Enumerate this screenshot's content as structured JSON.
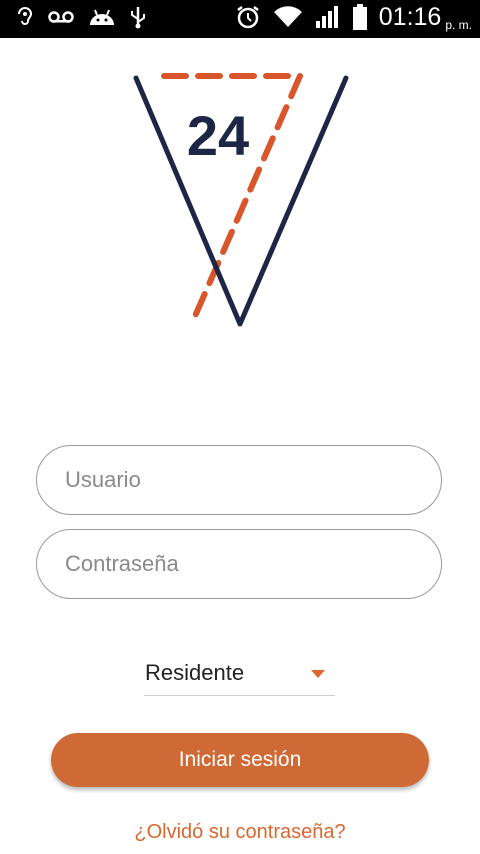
{
  "status_bar": {
    "time": "01:16",
    "ampm": "p. m.",
    "left_icons": [
      "hearing-aid-icon",
      "voicemail-icon",
      "android-icon",
      "usb-icon"
    ],
    "right_icons": [
      "alarm-icon",
      "wifi-icon",
      "signal-icon",
      "battery-icon"
    ]
  },
  "logo": {
    "number": "24",
    "colors": {
      "navy": "#1d2646",
      "orange": "#d9552b"
    }
  },
  "login": {
    "username_placeholder": "Usuario",
    "password_placeholder": "Contraseña",
    "role_selected": "Residente",
    "submit_label": "Iniciar sesión",
    "forgot_link": "¿Olvidó su contraseña?"
  },
  "colors": {
    "accent": "#cf6a36",
    "link": "#d9672f",
    "border": "#9a9a9a"
  }
}
